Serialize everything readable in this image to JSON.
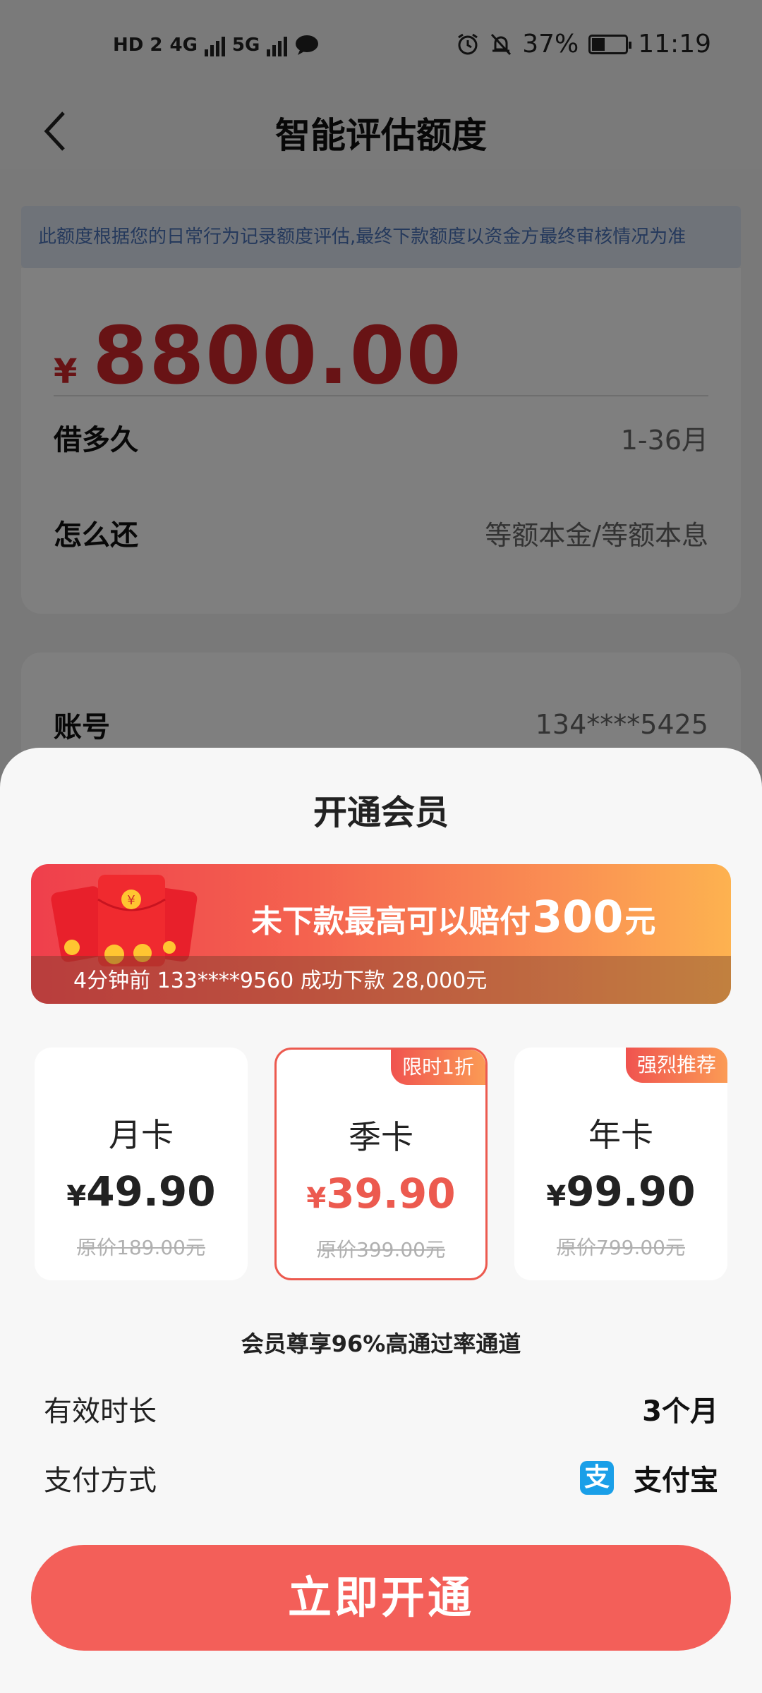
{
  "status_bar": {
    "left_badges": [
      "HD 2",
      "4G",
      "5G"
    ],
    "battery": "37%",
    "time": "11:19",
    "icons": [
      "hd-icon",
      "signal-icon",
      "signal-icon",
      "chat-bubble-icon",
      "alarm-icon",
      "bell-off-icon",
      "battery-icon"
    ]
  },
  "header": {
    "title": "智能评估额度",
    "back_icon": "chevron-left-icon"
  },
  "notice": "此额度根据您的日常行为记录额度评估,最终下款额度以资金方最终审核情况为准",
  "loan": {
    "currency": "¥",
    "amount": "8800.00",
    "term_label": "借多久",
    "term_value": "1-36月",
    "repay_label": "怎么还",
    "repay_value": "等额本金/等额本息",
    "account_label": "账号",
    "account_value": "134****5425"
  },
  "sheet": {
    "title": "开通会员",
    "promo": {
      "headline_prefix": "未下款最高可以赔付",
      "headline_amount": "300",
      "headline_suffix": "元",
      "ticker": "4分钟前 133****9560  成功下款 28,000元"
    },
    "plans": [
      {
        "name": "月卡",
        "currency": "¥",
        "price": "49.90",
        "original": "原价189.00元",
        "tag": "",
        "selected": false
      },
      {
        "name": "季卡",
        "currency": "¥",
        "price": "39.90",
        "original": "原价399.00元",
        "tag": "限时1折",
        "selected": true
      },
      {
        "name": "年卡",
        "currency": "¥",
        "price": "99.90",
        "original": "原价799.00元",
        "tag": "强烈推荐",
        "selected": false
      }
    ],
    "benefit": "会员尊享96%高通过率通道",
    "duration_label": "有效时长",
    "duration_value": "3个月",
    "payment_label": "支付方式",
    "payment_value": "支付宝",
    "payment_icon": "alipay-icon",
    "payment_icon_glyph": "支",
    "cta": "立即开通"
  },
  "colors": {
    "brand_red": "#d0262b",
    "cta": "#f35f59",
    "accent_gradient_start": "#ef3f4c",
    "accent_gradient_end": "#fdb250",
    "alipay_blue": "#1a9fe8"
  }
}
